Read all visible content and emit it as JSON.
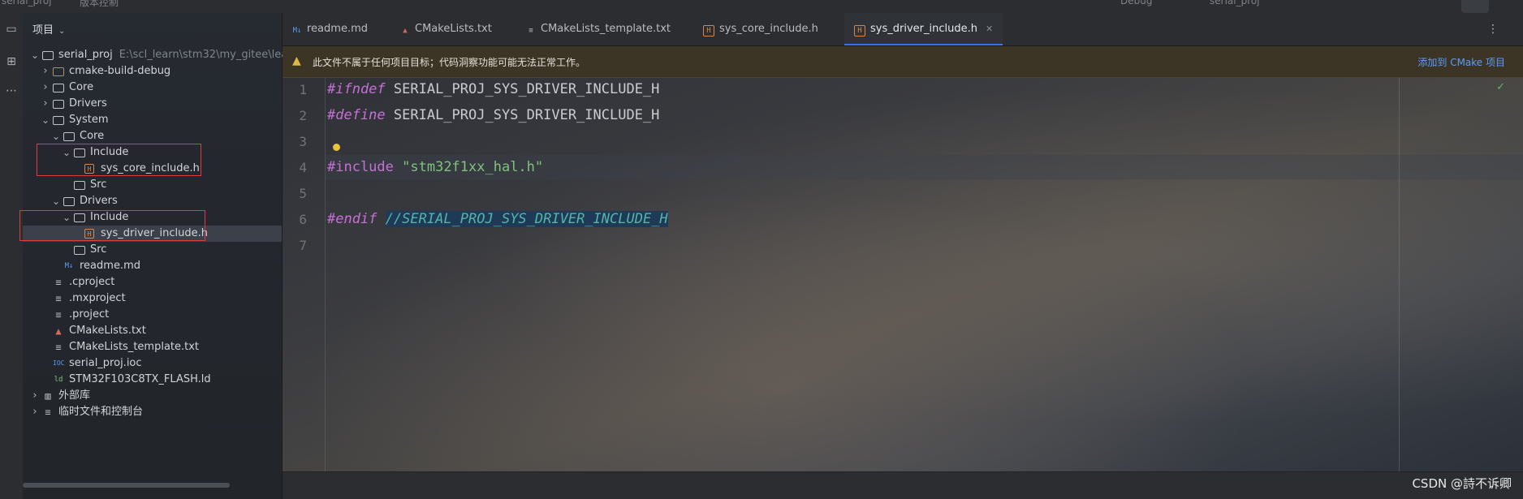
{
  "window": {
    "top_ghost_left": "serial_proj",
    "top_ghost_mid": "版本控制",
    "top_ghost_right1": "Debug",
    "top_ghost_right2": "serial_proj"
  },
  "project_panel": {
    "title": "项目",
    "tree": [
      {
        "label": "serial_proj",
        "path": "E:\\scl_learn\\stm32\\my_gitee\\lear",
        "depth": 0,
        "expanded": true,
        "icon": "folder-icon"
      },
      {
        "label": "cmake-build-debug",
        "depth": 1,
        "expanded": false,
        "icon": "folder-icon-orange"
      },
      {
        "label": "Core",
        "depth": 1,
        "expanded": false,
        "icon": "folder-icon"
      },
      {
        "label": "Drivers",
        "depth": 1,
        "expanded": false,
        "icon": "folder-icon"
      },
      {
        "label": "System",
        "depth": 1,
        "expanded": true,
        "icon": "folder-icon"
      },
      {
        "label": "Core",
        "depth": 2,
        "expanded": true,
        "icon": "folder-icon"
      },
      {
        "label": "Include",
        "depth": 3,
        "expanded": true,
        "icon": "folder-icon"
      },
      {
        "label": "sys_core_include.h",
        "depth": 4,
        "icon": "header-file-icon"
      },
      {
        "label": "Src",
        "depth": 3,
        "icon": "folder-icon"
      },
      {
        "label": "Drivers",
        "depth": 2,
        "expanded": true,
        "icon": "folder-icon"
      },
      {
        "label": "Include",
        "depth": 3,
        "expanded": true,
        "icon": "folder-icon"
      },
      {
        "label": "sys_driver_include.h",
        "depth": 4,
        "icon": "header-file-icon",
        "selected": true
      },
      {
        "label": "Src",
        "depth": 3,
        "icon": "folder-icon"
      },
      {
        "label": "readme.md",
        "depth": 2,
        "icon": "markdown-file-icon"
      },
      {
        "label": ".cproject",
        "depth": 1,
        "icon": "text-file-icon"
      },
      {
        "label": ".mxproject",
        "depth": 1,
        "icon": "text-file-icon"
      },
      {
        "label": ".project",
        "depth": 1,
        "icon": "text-file-icon"
      },
      {
        "label": "CMakeLists.txt",
        "depth": 1,
        "icon": "cmake-file-icon"
      },
      {
        "label": "CMakeLists_template.txt",
        "depth": 1,
        "icon": "text-file-icon"
      },
      {
        "label": "serial_proj.ioc",
        "depth": 1,
        "icon": "ioc-file-icon"
      },
      {
        "label": "STM32F103C8TX_FLASH.ld",
        "depth": 1,
        "icon": "ld-file-icon"
      },
      {
        "label": "外部库",
        "depth": 0,
        "expanded": false,
        "icon": "library-icon"
      },
      {
        "label": "临时文件和控制台",
        "depth": 0,
        "expanded": false,
        "icon": "scratch-icon"
      }
    ]
  },
  "tabs": [
    {
      "label": "readme.md",
      "icon": "markdown-file-icon"
    },
    {
      "label": "CMakeLists.txt",
      "icon": "cmake-file-icon"
    },
    {
      "label": "CMakeLists_template.txt",
      "icon": "text-file-icon"
    },
    {
      "label": "sys_core_include.h",
      "icon": "header-file-icon"
    },
    {
      "label": "sys_driver_include.h",
      "icon": "header-file-icon",
      "active": true
    }
  ],
  "banner": {
    "message": "此文件不属于任何项目目标；代码洞察功能可能无法正常工作。",
    "action": "添加到 CMake 项目"
  },
  "editor": {
    "line_numbers": [
      "1",
      "2",
      "3",
      "4",
      "5",
      "6",
      "7"
    ],
    "lines": [
      {
        "kw": "#ifndef",
        "rest": " SERIAL_PROJ_SYS_DRIVER_INCLUDE_H"
      },
      {
        "kw": "#define",
        "rest": " SERIAL_PROJ_SYS_DRIVER_INCLUDE_H"
      },
      {
        "kw": "",
        "rest": ""
      },
      {
        "kw": "#include",
        "str": "\"stm32f1xx_hal.h\""
      },
      {
        "kw": "",
        "rest": ""
      },
      {
        "kw": "#endif",
        "comment": "//SERIAL_PROJ_SYS_DRIVER_INCLUDE_H"
      },
      {
        "kw": "",
        "rest": ""
      }
    ]
  },
  "watermark": "CSDN @詩不诉卿",
  "colors": {
    "accent": "#3574f0",
    "keyword": "#c86fd8",
    "string": "#7ec27b",
    "comment": "#54b5a7",
    "highlight_box": "#e03c3c"
  }
}
